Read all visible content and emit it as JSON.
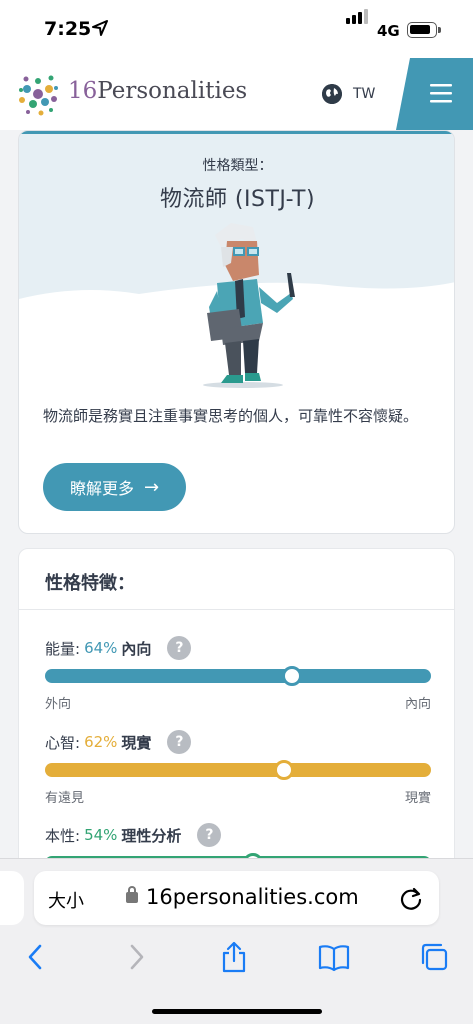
{
  "status_bar": {
    "time": "7:25",
    "network": "4G"
  },
  "header": {
    "brand_number": "16",
    "brand_name": "Personalities",
    "language": "TW"
  },
  "card": {
    "label": "性格類型：",
    "title": "物流師 (ISTJ-T)",
    "description": "物流師是務實且注重事實思考的個人，可靠性不容懷疑。",
    "button_label": "瞭解更多",
    "button_arrow": "→"
  },
  "traits": {
    "heading": "性格特徵：",
    "items": [
      {
        "name": "能量:",
        "percent": "64%",
        "type": "內向",
        "help": "?",
        "left_label": "外向",
        "right_label": "內向",
        "value": 64,
        "color": "#4298b4"
      },
      {
        "name": "心智:",
        "percent": "62%",
        "type": "現實",
        "help": "?",
        "left_label": "有遠見",
        "right_label": "現實",
        "value": 62,
        "color": "#e4ae3a"
      },
      {
        "name": "本性:",
        "percent": "54%",
        "type": "理性分析",
        "help": "?",
        "left_label": "",
        "right_label": "",
        "value": 54,
        "color": "#33a474"
      }
    ]
  },
  "browser": {
    "text_size_label": "大小",
    "url": "16personalities.com"
  },
  "icons": {
    "location": "location-arrow-icon",
    "globe": "globe-icon",
    "menu": "hamburger-menu-icon",
    "lock": "lock-icon",
    "reload": "reload-icon",
    "back": "back-chevron-icon",
    "forward": "forward-chevron-icon",
    "share": "share-icon",
    "bookmarks": "bookmarks-book-icon",
    "tabs": "tabs-icon"
  }
}
